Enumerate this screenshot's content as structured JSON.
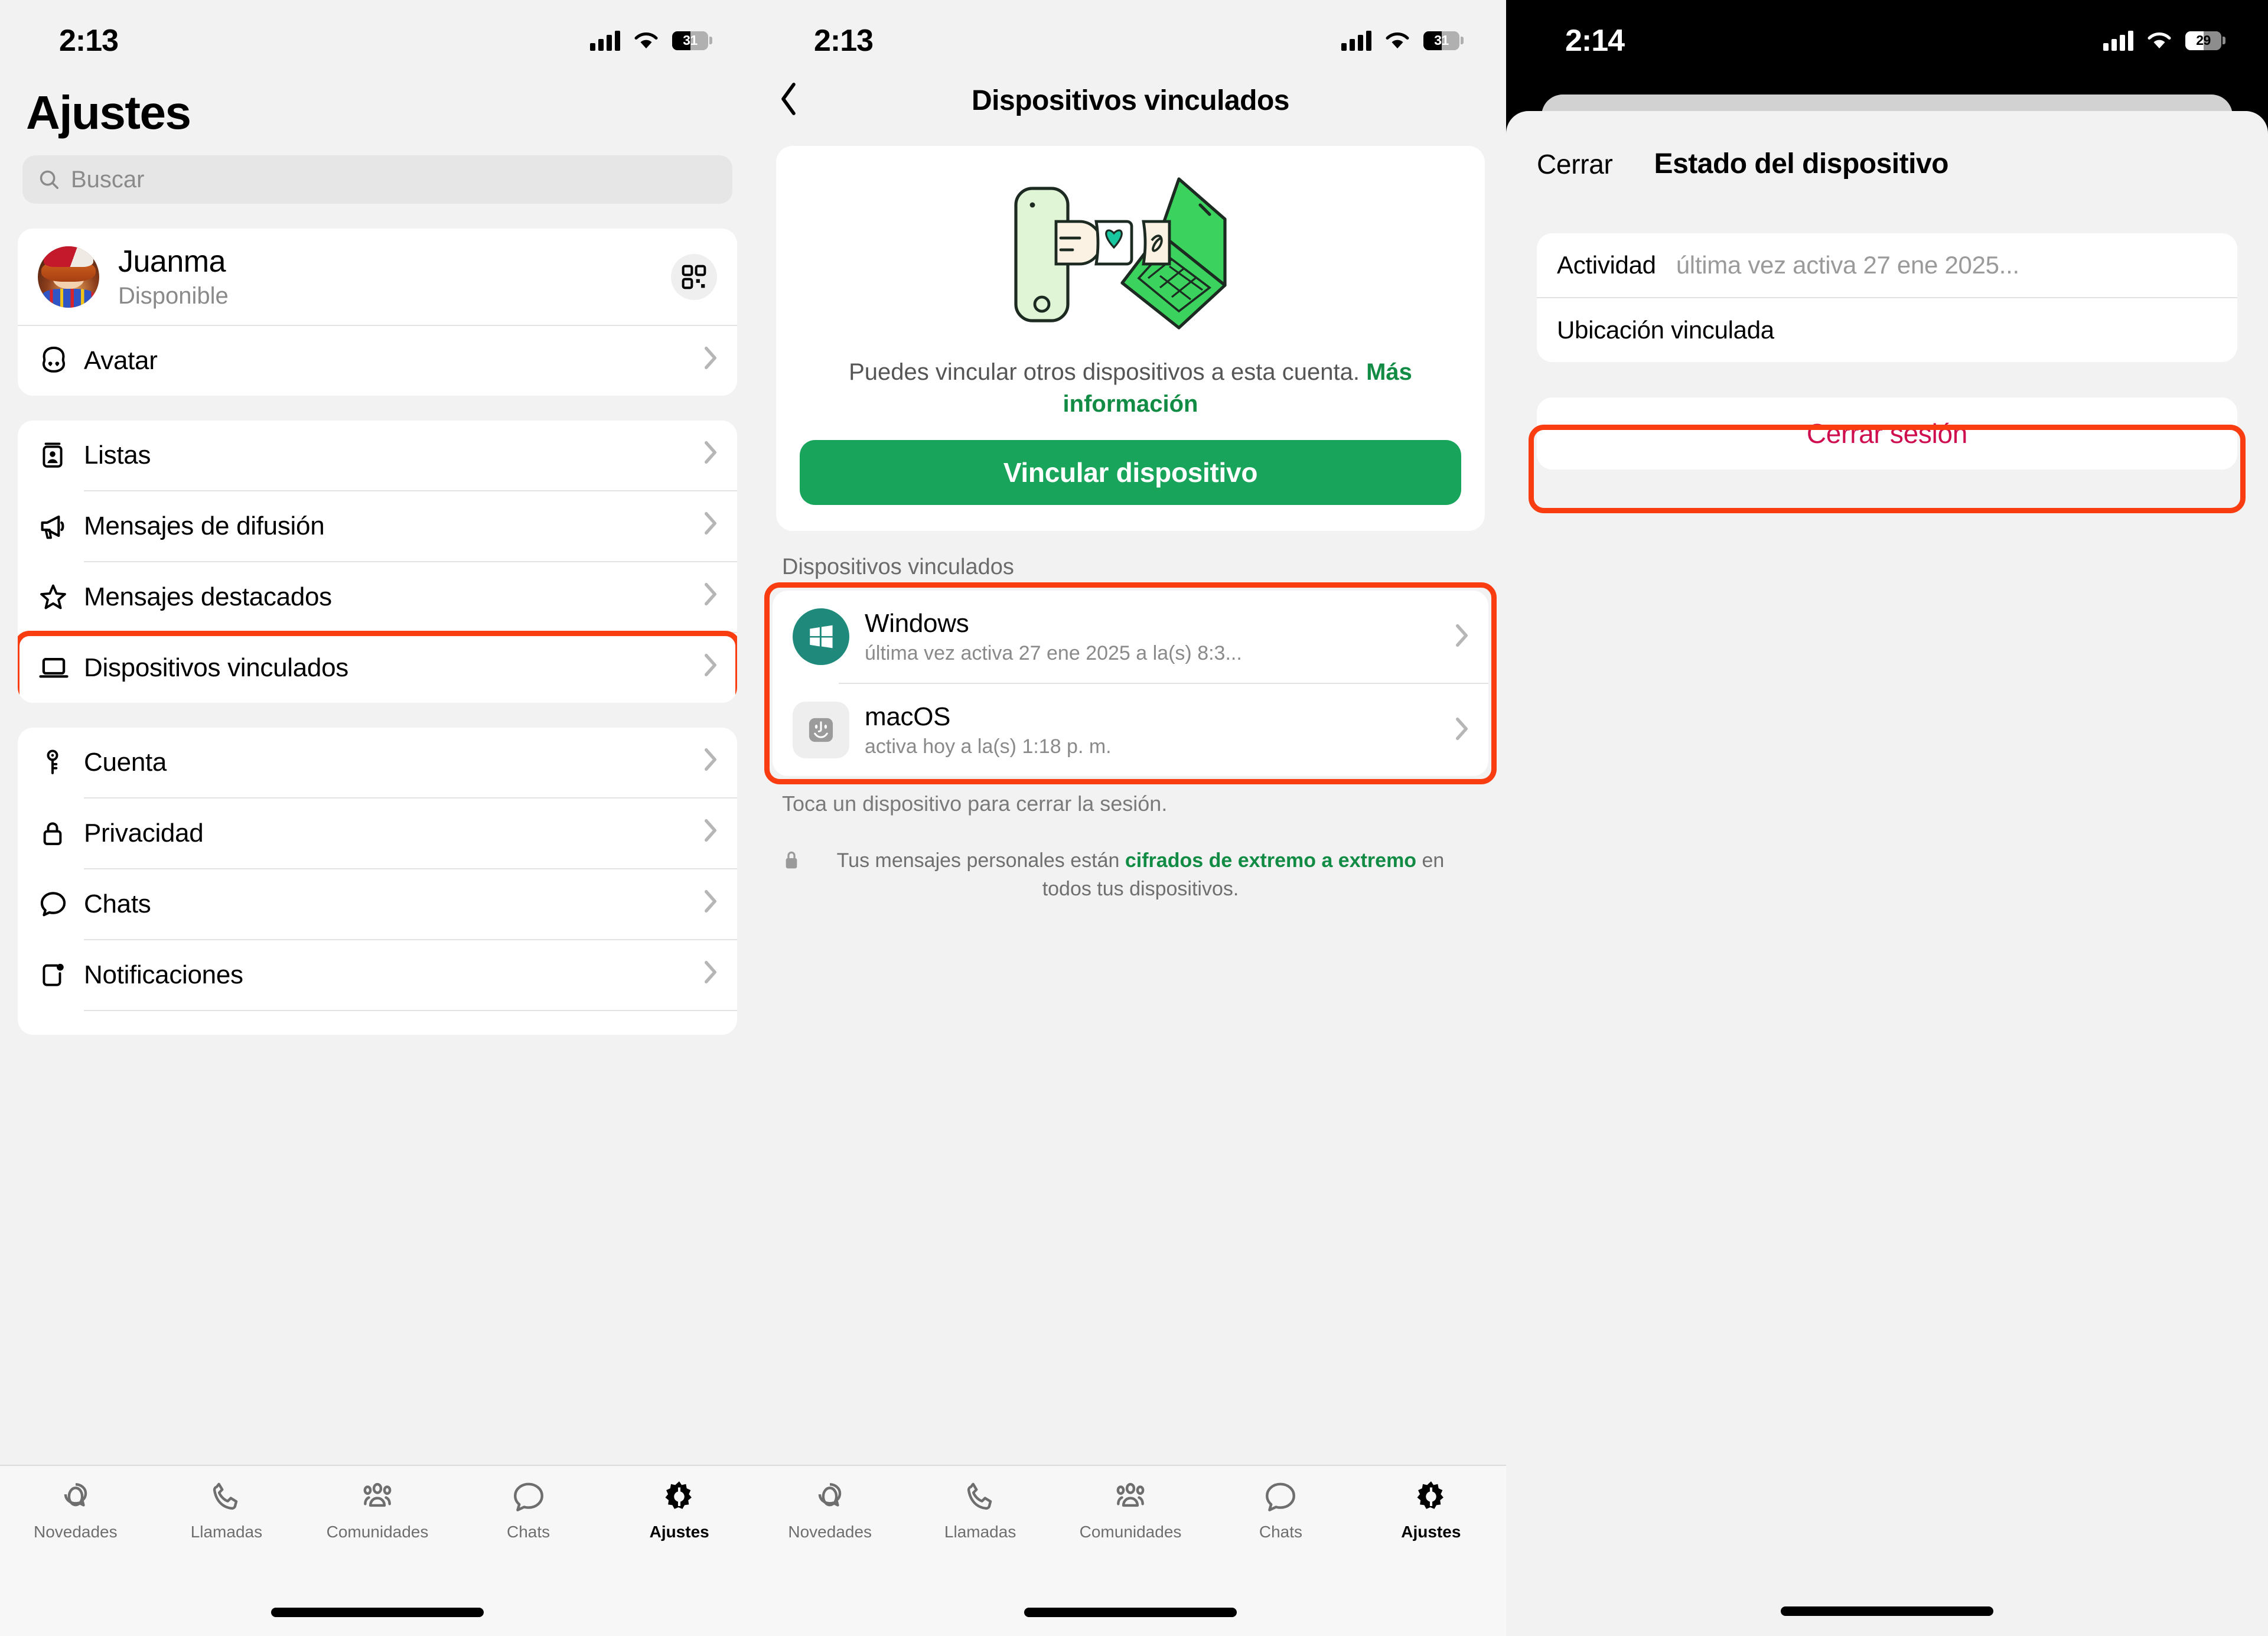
{
  "colors": {
    "accent_green": "#19a45b",
    "link_green": "#128c45",
    "highlight_red": "#fa3c11",
    "danger": "#cf0e4e",
    "windows_icon_bg": "#1f8a7c"
  },
  "screen1": {
    "status": {
      "time": "2:13",
      "battery": "31"
    },
    "title": "Ajustes",
    "search": {
      "placeholder": "Buscar"
    },
    "profile": {
      "name": "Juanma",
      "status": "Disponible",
      "qr_icon": "qr-code-icon"
    },
    "avatar_row": {
      "label": "Avatar",
      "icon": "avatar-face-icon"
    },
    "group_a": [
      {
        "label": "Listas",
        "icon": "lists-icon"
      },
      {
        "label": "Mensajes de difusión",
        "icon": "megaphone-icon"
      },
      {
        "label": "Mensajes destacados",
        "icon": "star-icon"
      },
      {
        "label": "Dispositivos vinculados",
        "icon": "laptop-icon",
        "highlighted": true
      }
    ],
    "group_b": [
      {
        "label": "Cuenta",
        "icon": "key-icon"
      },
      {
        "label": "Privacidad",
        "icon": "lock-icon"
      },
      {
        "label": "Chats",
        "icon": "chat-bubble-icon"
      },
      {
        "label": "Notificaciones",
        "icon": "notification-icon"
      }
    ],
    "tabs": [
      {
        "label": "Novedades",
        "icon": "status-ring-icon",
        "active": false
      },
      {
        "label": "Llamadas",
        "icon": "phone-icon",
        "active": false
      },
      {
        "label": "Comunidades",
        "icon": "communities-icon",
        "active": false
      },
      {
        "label": "Chats",
        "icon": "chat-bubble-icon",
        "active": false
      },
      {
        "label": "Ajustes",
        "icon": "gear-icon",
        "active": true
      }
    ]
  },
  "screen2": {
    "status": {
      "time": "2:13",
      "battery": "31"
    },
    "nav": {
      "back_icon": "back-chevron-icon",
      "title": "Dispositivos vinculados"
    },
    "hero": {
      "illustration": "phone-heart-laptop-illustration",
      "text_before": "Puedes vincular otros dispositivos a esta cuenta. ",
      "link": "Más información",
      "cta": "Vincular dispositivo"
    },
    "section_header": "Dispositivos vinculados",
    "devices": [
      {
        "name": "Windows",
        "sub": "última vez activa 27 ene 2025 a la(s) 8:3...",
        "icon": "windows-logo-icon"
      },
      {
        "name": "macOS",
        "sub": "activa hoy a la(s) 1:18 p. m.",
        "icon": "macos-finder-icon"
      }
    ],
    "hint": "Toca un dispositivo para cerrar la sesión.",
    "encryption": {
      "icon": "lock-icon",
      "before": "Tus mensajes personales están ",
      "bold": "cifrados de extremo a extremo",
      "after": " en todos tus dispositivos."
    },
    "tabs": [
      {
        "label": "Novedades",
        "icon": "status-ring-icon",
        "active": false
      },
      {
        "label": "Llamadas",
        "icon": "phone-icon",
        "active": false
      },
      {
        "label": "Comunidades",
        "icon": "communities-icon",
        "active": false
      },
      {
        "label": "Chats",
        "icon": "chat-bubble-icon",
        "active": false
      },
      {
        "label": "Ajustes",
        "icon": "gear-icon",
        "active": true
      }
    ]
  },
  "screen3": {
    "status": {
      "time": "2:14",
      "battery": "29"
    },
    "sheet": {
      "close_label": "Cerrar",
      "title": "Estado del dispositivo",
      "rows": [
        {
          "key": "Actividad",
          "value": "última vez activa 27 ene 2025..."
        },
        {
          "key": "Ubicación vinculada",
          "value": ""
        }
      ],
      "logout_label": "Cerrar sesión"
    }
  }
}
